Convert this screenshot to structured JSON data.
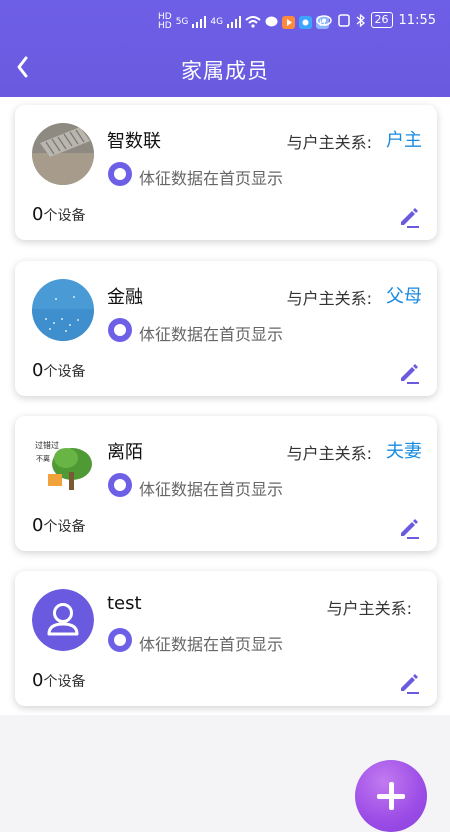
{
  "status_bar": {
    "network_left": "HD 1 / HD 2",
    "signal_5g": "5G",
    "signal_4g": "4G",
    "battery": "26",
    "time": "11:55"
  },
  "header": {
    "title": "家属成员"
  },
  "colors": {
    "primary": "#6a5ae0",
    "relation_value": "#1a8be0",
    "fab": "#9b4ce6"
  },
  "members": [
    {
      "name": "智数联",
      "relation_label": "与户主关系:",
      "relation_value": "户主",
      "toggle_label": "体征数据在首页显示",
      "device_count": "0",
      "device_unit": "个设备",
      "avatar": "photo-pavement"
    },
    {
      "name": "金融",
      "relation_label": "与户主关系:",
      "relation_value": "父母",
      "toggle_label": "体征数据在首页显示",
      "device_count": "0",
      "device_unit": "个设备",
      "avatar": "photo-blue-sky"
    },
    {
      "name": "离陌",
      "relation_label": "与户主关系:",
      "relation_value": "夫妻",
      "toggle_label": "体征数据在首页显示",
      "device_count": "0",
      "device_unit": "个设备",
      "avatar": "photo-tree-cartoon",
      "avatar_text_1": "过错过",
      "avatar_text_2": "不离"
    },
    {
      "name": "test",
      "relation_label": "与户主关系:",
      "relation_value": "",
      "toggle_label": "体征数据在首页显示",
      "device_count": "0",
      "device_unit": "个设备",
      "avatar": "default-user-icon"
    }
  ],
  "fab": {
    "icon": "plus-icon"
  }
}
